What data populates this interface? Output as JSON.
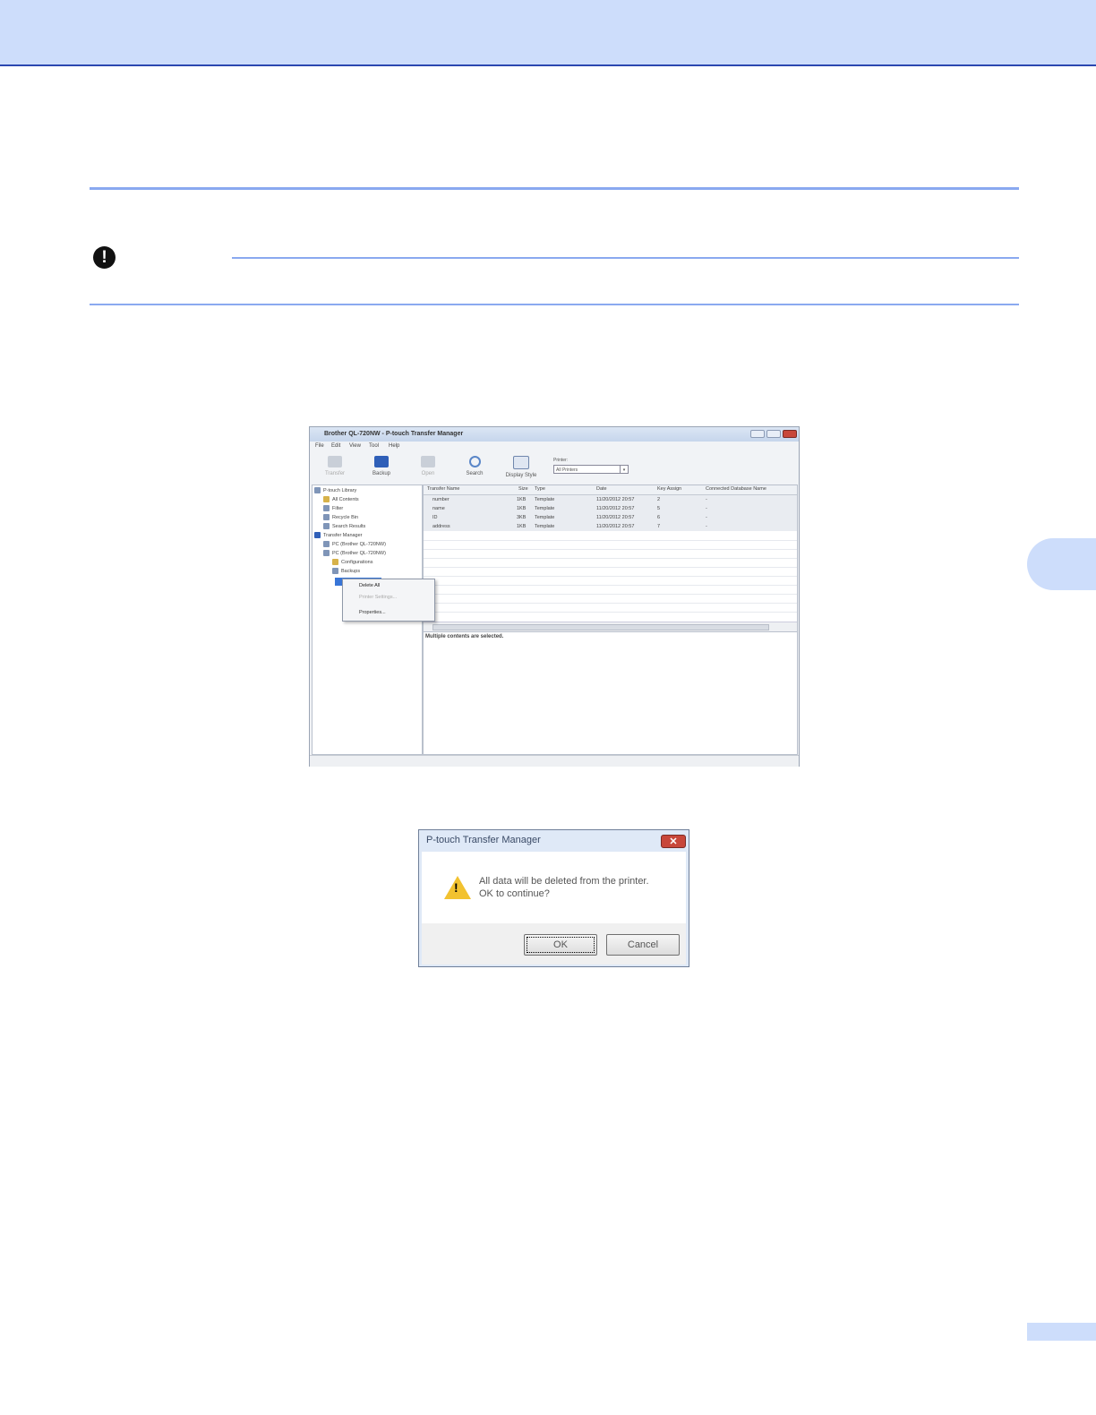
{
  "app_window": {
    "title": "Brother QL-720NW - P-touch Transfer Manager",
    "menu": [
      "File",
      "Edit",
      "View",
      "Tool",
      "Help"
    ],
    "toolbar": [
      "Transfer",
      "Backup",
      "Open",
      "Search",
      "Display Style"
    ],
    "printer_label": "Printer:",
    "printer_value": "All Printers",
    "tree": [
      "P-touch Library",
      "All Contents",
      "Filter",
      "Recycle Bin",
      "Search Results",
      "Transfer Manager",
      "PC (Brother QL-720NW)",
      "PC (Brother QL-720NW)",
      "Configurations",
      "Backups"
    ],
    "columns": [
      "Transfer Name",
      "Size",
      "Type",
      "Date",
      "Key Assign",
      "Connected Database Name"
    ],
    "rows": [
      {
        "name": "number",
        "size": "1KB",
        "type": "Template",
        "date": "11/20/2012 20:57",
        "key": "2",
        "db": "-"
      },
      {
        "name": "name",
        "size": "1KB",
        "type": "Template",
        "date": "11/20/2012 20:57",
        "key": "5",
        "db": "-"
      },
      {
        "name": "ID",
        "size": "3KB",
        "type": "Template",
        "date": "11/20/2012 20:57",
        "key": "6",
        "db": "-"
      },
      {
        "name": "address",
        "size": "1KB",
        "type": "Template",
        "date": "11/20/2012 20:57",
        "key": "7",
        "db": "-"
      }
    ],
    "detail_text": "Multiple contents are selected.",
    "context_menu": [
      "Delete All",
      "Printer Settings...",
      "Properties..."
    ]
  },
  "dialog": {
    "title": "P-touch Transfer Manager",
    "message_line1": "All data will be deleted from the printer.",
    "message_line2": "OK to continue?",
    "ok_label": "OK",
    "cancel_label": "Cancel",
    "close_glyph": "✕"
  },
  "icons": {
    "important": "!",
    "warning": "!"
  },
  "colors": {
    "header_band": "#cdddfb",
    "rule": "#8aa9f0",
    "selection": "#3875d7"
  }
}
